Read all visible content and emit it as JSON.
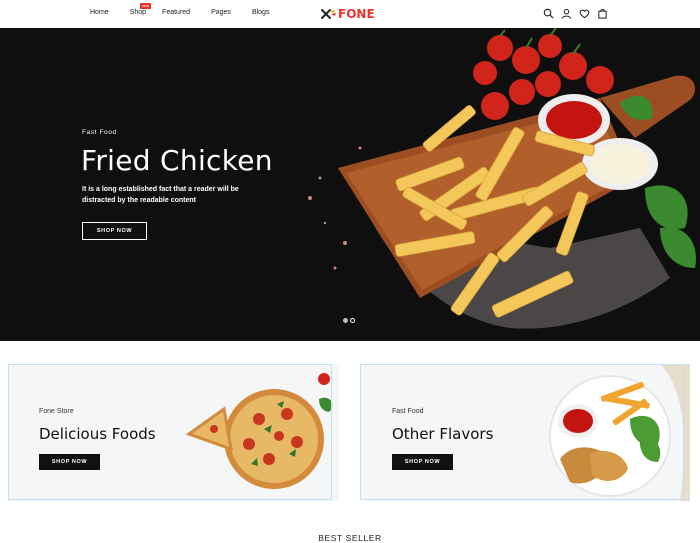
{
  "header": {
    "nav": [
      {
        "label": "Home"
      },
      {
        "label": "Shop",
        "badge": "new"
      },
      {
        "label": "Featured"
      },
      {
        "label": "Pages"
      },
      {
        "label": "Blogs"
      }
    ],
    "logo_text": "FONE",
    "icons": [
      "search-icon",
      "user-icon",
      "heart-icon",
      "bag-icon"
    ]
  },
  "hero": {
    "kicker": "Fast Food",
    "title": "Fried Chicken",
    "description": "It is a long established fact that a reader will be distracted by the readable content",
    "button": "SHOP NOW",
    "slides_total": 2,
    "active_slide": 1
  },
  "banners": [
    {
      "kicker": "Fone Store",
      "title": "Delicious Foods",
      "button": "SHOP NOW"
    },
    {
      "kicker": "Fast Food",
      "title": "Other Flavors",
      "button": "SHOP NOW"
    }
  ],
  "section_heading": "BEST SELLER",
  "colors": {
    "accent": "#e8322b",
    "hero_bg": "#0f0f0f",
    "banner_bg": "#f4f6f7"
  }
}
